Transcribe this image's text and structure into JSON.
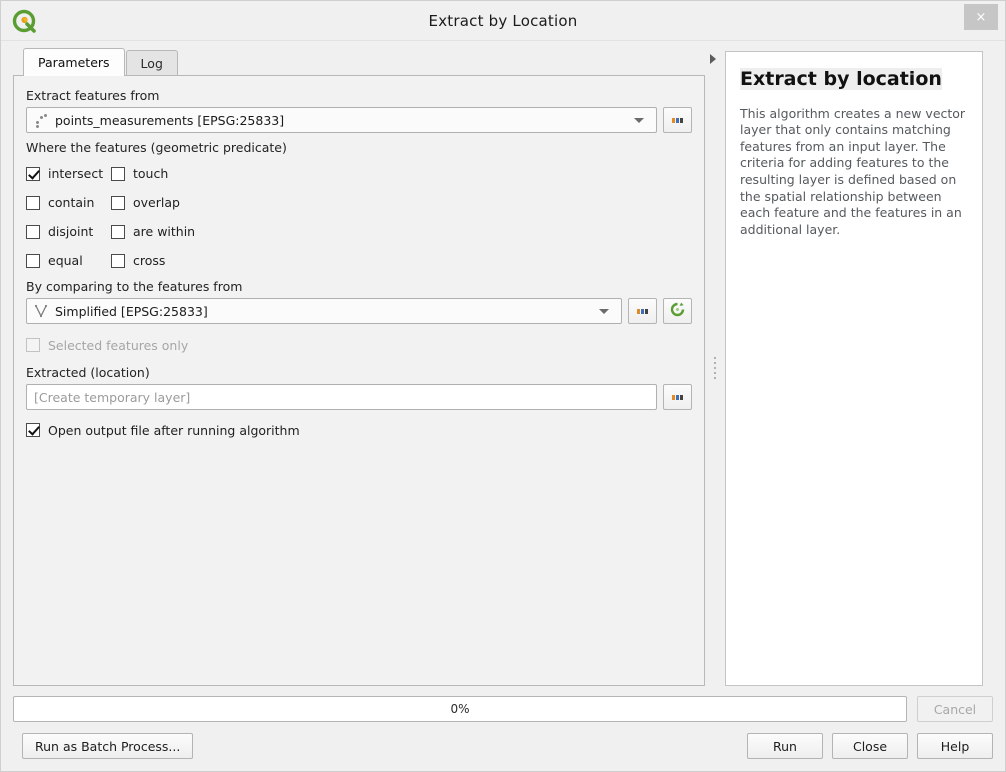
{
  "window": {
    "title": "Extract by Location",
    "logo_icon": "qgis-logo-icon",
    "close_label": "×"
  },
  "tabs": [
    {
      "label": "Parameters",
      "active": true
    },
    {
      "label": "Log",
      "active": false
    }
  ],
  "parameters": {
    "input_label": "Extract features from",
    "input_layer": "points_measurements [EPSG:25833]",
    "input_layer_icon": "point-layer-icon",
    "predicate_label": "Where the features (geometric predicate)",
    "predicates": [
      {
        "label": "intersect",
        "checked": true
      },
      {
        "label": "touch",
        "checked": false
      },
      {
        "label": "contain",
        "checked": false
      },
      {
        "label": "overlap",
        "checked": false
      },
      {
        "label": "disjoint",
        "checked": false
      },
      {
        "label": "are within",
        "checked": false
      },
      {
        "label": "equal",
        "checked": false
      },
      {
        "label": "cross",
        "checked": false
      }
    ],
    "compare_label": "By comparing to the features from",
    "compare_layer": "Simplified [EPSG:25833]",
    "compare_layer_icon": "line-layer-icon",
    "iterate_icon": "iterate-refresh-icon",
    "browse_icon": "ellipsis-icon",
    "selected_only": {
      "label": "Selected features only",
      "checked": false,
      "enabled": false
    },
    "output_label": "Extracted (location)",
    "output_placeholder": "[Create temporary layer]",
    "output_value": "",
    "open_output": {
      "label": "Open output file after running algorithm",
      "checked": true
    }
  },
  "help": {
    "title": "Extract by location",
    "text": "This algorithm creates a new vector layer that only contains matching features from an input layer. The criteria for adding features to the resulting layer is defined based on the spatial relationship between each feature and the features in an additional layer."
  },
  "footer": {
    "progress_text": "0%",
    "progress_percent": 0,
    "cancel_label": "Cancel",
    "batch_label": "Run as Batch Process...",
    "run_label": "Run",
    "close_label": "Close",
    "help_label": "Help"
  },
  "colors": {
    "accent_green": "#5a9e33",
    "accent_orange": "#e8a020",
    "window_bg": "#f0f0f0",
    "panel_bg": "#f2f2f2"
  }
}
